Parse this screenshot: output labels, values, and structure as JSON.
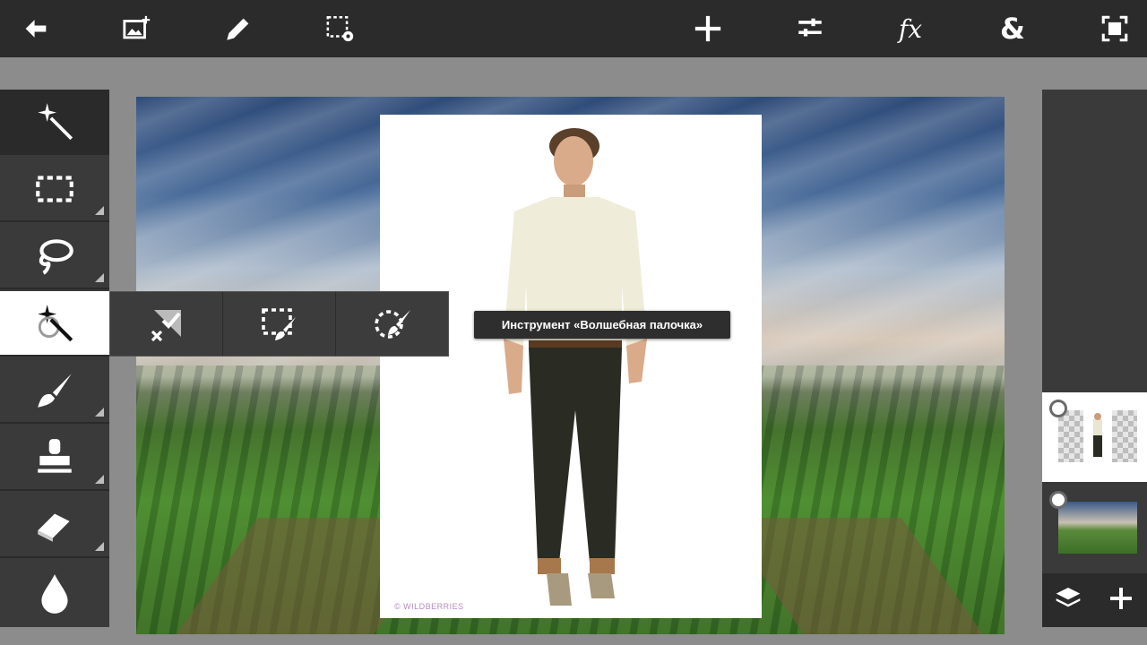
{
  "topbar": {
    "buttons": [
      {
        "name": "back-button",
        "icon": "back-arrow-icon"
      },
      {
        "name": "add-image-button",
        "icon": "add-image-icon"
      },
      {
        "name": "edit-button",
        "icon": "pencil-icon"
      },
      {
        "name": "selection-settings-button",
        "icon": "selection-gear-icon"
      },
      {
        "name": "transform-button",
        "icon": "move-icon"
      },
      {
        "name": "adjustments-button",
        "icon": "sliders-icon"
      },
      {
        "name": "effects-button",
        "label": "fx"
      },
      {
        "name": "blend-button",
        "label": "&"
      },
      {
        "name": "fullscreen-button",
        "icon": "fullscreen-icon"
      }
    ]
  },
  "tools": [
    {
      "name": "magic-wand-tool",
      "icon": "magic-wand-icon"
    },
    {
      "name": "marquee-tool",
      "icon": "rect-select-icon"
    },
    {
      "name": "lasso-tool",
      "icon": "lasso-icon"
    },
    {
      "name": "magic-wand-active-tool",
      "icon": "magic-wand-select-icon",
      "active": true
    },
    {
      "name": "brush-tool",
      "icon": "brush-icon"
    },
    {
      "name": "clone-stamp-tool",
      "icon": "stamp-icon"
    },
    {
      "name": "eraser-tool",
      "icon": "eraser-icon"
    },
    {
      "name": "blur-tool",
      "icon": "drop-icon"
    }
  ],
  "subtools": [
    {
      "name": "deselect-subtool",
      "icon": "deselect-icon"
    },
    {
      "name": "refine-rect-subtool",
      "icon": "rect-brush-icon"
    },
    {
      "name": "refine-lasso-subtool",
      "icon": "lasso-brush-icon"
    }
  ],
  "tooltip": {
    "text": "Инструмент «Волшебная палочка»"
  },
  "photo": {
    "watermark": "© WILDBERRIES"
  },
  "layers": {
    "items": [
      {
        "name": "layer-person",
        "active": true
      },
      {
        "name": "layer-background",
        "active": false
      }
    ],
    "footer": [
      {
        "name": "layers-button",
        "icon": "layers-icon"
      },
      {
        "name": "add-layer-button",
        "icon": "plus-icon"
      }
    ]
  },
  "colors": {
    "topbar": "#2b2b2b",
    "panel": "#3a3a3a",
    "background": "#8c8c8c"
  }
}
